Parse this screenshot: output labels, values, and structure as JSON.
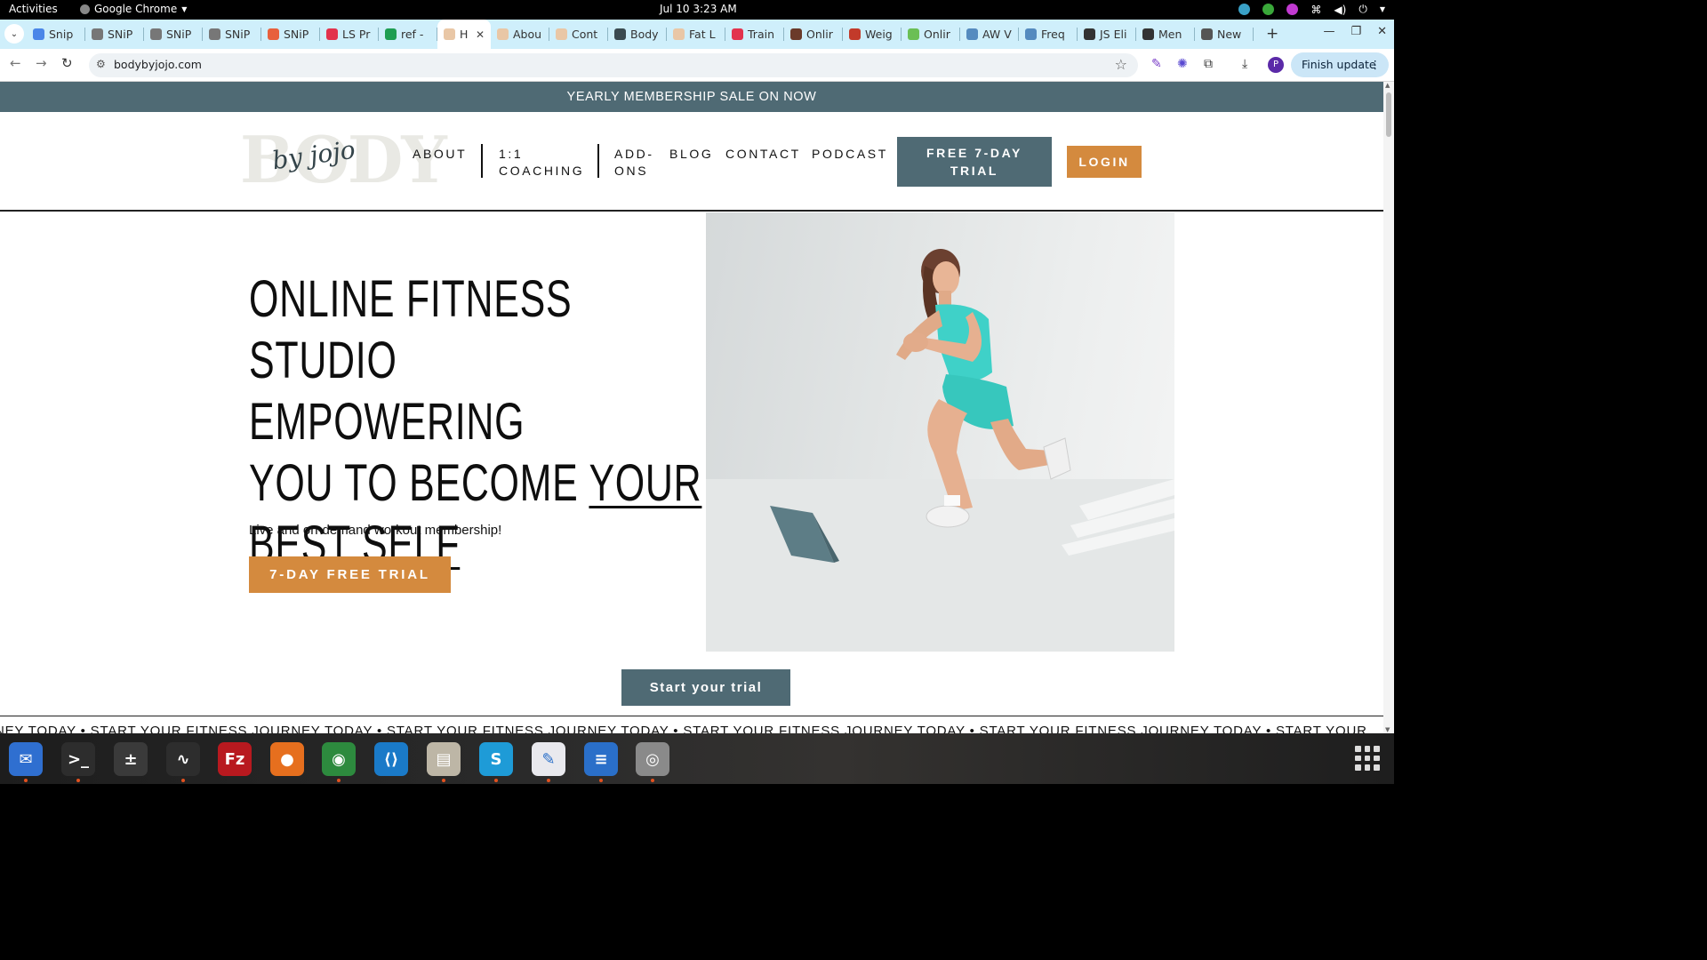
{
  "topbar": {
    "activities": "Activities",
    "app_name": "Google Chrome",
    "clock": "Jul 10  3:23 AM"
  },
  "tabs": [
    {
      "label": "Snip",
      "color": "#4a86e8"
    },
    {
      "label": "SNiP",
      "color": "#777777"
    },
    {
      "label": "SNiP",
      "color": "#777777"
    },
    {
      "label": "SNiP",
      "color": "#777777"
    },
    {
      "label": "SNiP",
      "color": "#e8603c"
    },
    {
      "label": "LS Pr",
      "color": "#e2334d"
    },
    {
      "label": "ref -",
      "color": "#1e9e52"
    },
    {
      "label": "H",
      "color": "#e9c7a6",
      "active": true
    },
    {
      "label": "Abou",
      "color": "#e9c7a6"
    },
    {
      "label": "Cont",
      "color": "#e9c7a6"
    },
    {
      "label": "Body",
      "color": "#3b4a50"
    },
    {
      "label": "Fat L",
      "color": "#e9c7a6"
    },
    {
      "label": "Train",
      "color": "#e2334d"
    },
    {
      "label": "Onlir",
      "color": "#6b3a2a"
    },
    {
      "label": "Weig",
      "color": "#c23a2a"
    },
    {
      "label": "Onlir",
      "color": "#6bbf55"
    },
    {
      "label": "AW V",
      "color": "#558bbf"
    },
    {
      "label": "Freq",
      "color": "#558bbf"
    },
    {
      "label": "JS Eli",
      "color": "#333333"
    },
    {
      "label": "Men",
      "color": "#333333"
    },
    {
      "label": "New",
      "color": "#555555"
    }
  ],
  "toolbar": {
    "url": "bodybyjojo.com",
    "finish_update": "Finish update",
    "avatar_letter": "P"
  },
  "site": {
    "announcement": "YEARLY MEMBERSHIP SALE ON NOW",
    "logo_big": "BODY",
    "logo_script": "by jojo",
    "nav": {
      "about": "ABOUT",
      "coaching_line1": "1:1",
      "coaching_line2": "COACHING",
      "addons_line1": "ADD-",
      "addons_line2": "ONS",
      "blog": "BLOG",
      "contact": "CONTACT",
      "podcast": "PODCAST"
    },
    "trial_line1": "FREE 7-DAY",
    "trial_line2": "TRIAL",
    "login": "LOGIN",
    "hero_line1": "ONLINE FITNESS",
    "hero_line2": "STUDIO EMPOWERING",
    "hero_line3a": "YOU TO BECOME ",
    "hero_line3b": "YOUR",
    "hero_line4": "BEST SELF",
    "hero_sub": "Live and on-demand workout membership!",
    "hero_cta": "7-DAY FREE TRIAL",
    "start_cta": "Start your trial",
    "ticker": "NEY TODAY • START YOUR FITNESS JOURNEY TODAY • START YOUR FITNESS JOURNEY TODAY • START YOUR FITNESS JOURNEY TODAY • START YOUR FITNESS JOURNEY TODAY • START YOUR"
  },
  "dock": [
    {
      "name": "thunderbird-icon",
      "color": "#2f6fd0",
      "glyph": "✉"
    },
    {
      "name": "terminal-icon",
      "color": "#2d2d2d",
      "glyph": ">_"
    },
    {
      "name": "calculator-icon",
      "color": "#3a3a3a",
      "glyph": "±"
    },
    {
      "name": "system-monitor-icon",
      "color": "#2d2d2d",
      "glyph": "∿"
    },
    {
      "name": "filezilla-icon",
      "color": "#b8191f",
      "glyph": "Fz"
    },
    {
      "name": "firefox-icon",
      "color": "#e66f1e",
      "glyph": "●"
    },
    {
      "name": "chrome-icon",
      "color": "#2d8a3e",
      "glyph": "◉"
    },
    {
      "name": "vscode-icon",
      "color": "#1a7ac8",
      "glyph": "⟨⟩"
    },
    {
      "name": "files-icon",
      "color": "#bdb6a6",
      "glyph": "▤"
    },
    {
      "name": "skype-icon",
      "color": "#1e9bd7",
      "glyph": "S"
    },
    {
      "name": "text-editor-icon",
      "color": "#e9e9ee",
      "glyph": "✎"
    },
    {
      "name": "libreoffice-writer-icon",
      "color": "#2a6fc9",
      "glyph": "≡"
    },
    {
      "name": "disk-icon",
      "color": "#8a8a8a",
      "glyph": "◎"
    }
  ]
}
